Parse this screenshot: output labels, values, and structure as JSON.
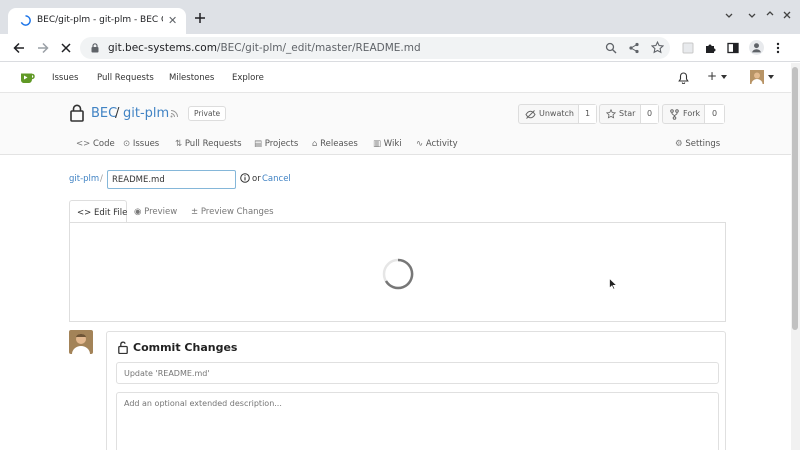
{
  "browser": {
    "tab_title": "BEC/git-plm - git-plm - BEC Git",
    "tab_close": "✕",
    "new_tab": "+",
    "url_host": "git.bec-systems.com",
    "url_path": "/BEC/git-plm/_edit/master/README.md"
  },
  "nav": {
    "items": [
      "Issues",
      "Pull Requests",
      "Milestones",
      "Explore"
    ],
    "create_label": "+"
  },
  "repo": {
    "owner": "BEC",
    "slash": "/",
    "name": "git-plm",
    "visibility": "Private",
    "unwatch_label": "Unwatch",
    "unwatch_count": "1",
    "star_label": "Star",
    "star_count": "0",
    "fork_label": "Fork",
    "fork_count": "0",
    "tabs": [
      "Code",
      "Issues",
      "Pull Requests",
      "Projects",
      "Releases",
      "Wiki",
      "Activity"
    ],
    "settings_label": "Settings"
  },
  "editor": {
    "breadcrumb_root": "git-plm",
    "breadcrumb_sep": "/",
    "filename": "README.md",
    "or_text": "or",
    "cancel_label": "Cancel",
    "tabs": [
      "Edit File",
      "Preview",
      "Preview Changes"
    ]
  },
  "commit": {
    "title": "Commit Changes",
    "summary_placeholder": "Update 'README.md'",
    "description_placeholder": "Add an optional extended description..."
  },
  "colors": {
    "accent": "#4183c4",
    "gitea_green": "#609926"
  }
}
